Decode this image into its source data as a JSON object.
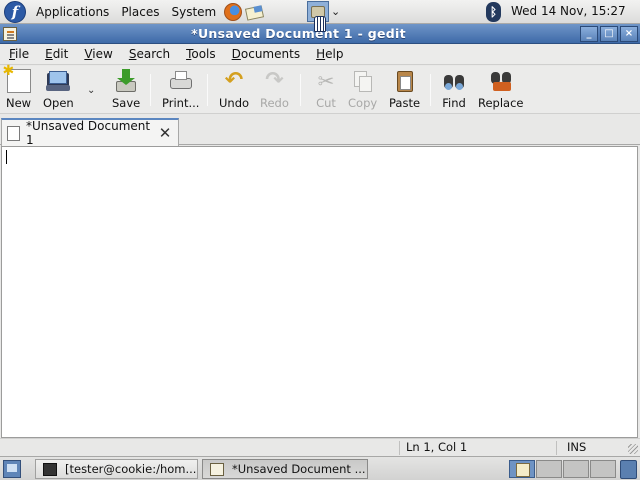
{
  "top_panel": {
    "menus": [
      "Applications",
      "Places",
      "System"
    ],
    "clock": "Wed 14 Nov, 15:27",
    "icons": [
      "fedora-logo-icon",
      "firefox-icon",
      "mail-icon",
      "applet-icon",
      "bluetooth-icon"
    ]
  },
  "window": {
    "title": "*Unsaved Document 1 - gedit",
    "controls": [
      "_",
      "□",
      "×"
    ]
  },
  "menubar": {
    "items": [
      {
        "pre": "",
        "key": "F",
        "post": "ile"
      },
      {
        "pre": "",
        "key": "E",
        "post": "dit"
      },
      {
        "pre": "",
        "key": "V",
        "post": "iew"
      },
      {
        "pre": "",
        "key": "S",
        "post": "earch"
      },
      {
        "pre": "",
        "key": "T",
        "post": "ools"
      },
      {
        "pre": "",
        "key": "D",
        "post": "ocuments"
      },
      {
        "pre": "",
        "key": "H",
        "post": "elp"
      }
    ]
  },
  "toolbar": {
    "new": "New",
    "open": "Open",
    "save": "Save",
    "print": "Print...",
    "undo": "Undo",
    "redo": "Redo",
    "cut": "Cut",
    "copy": "Copy",
    "paste": "Paste",
    "find": "Find",
    "replace": "Replace",
    "dropdown_glyph": "⌄"
  },
  "tab": {
    "label": "*Unsaved Document 1",
    "close_glyph": "✕"
  },
  "editor": {
    "content": ""
  },
  "statusbar": {
    "position": "Ln 1, Col 1",
    "mode": "INS"
  },
  "taskbar": {
    "tasks": [
      {
        "label": "[tester@cookie:/hom..."
      },
      {
        "label": "*Unsaved Document ..."
      }
    ]
  }
}
